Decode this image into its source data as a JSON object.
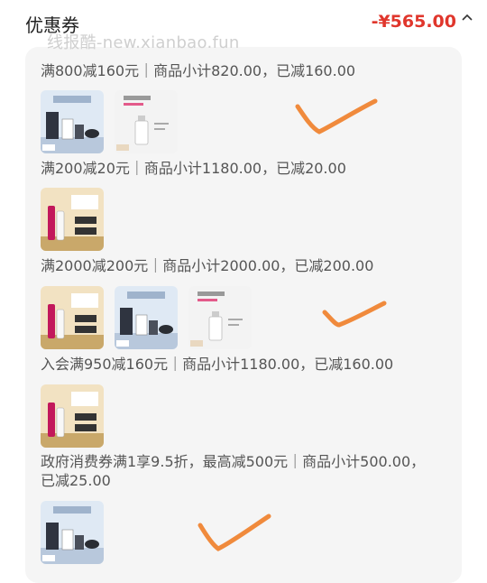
{
  "header": {
    "title": "优惠券",
    "amount": "-¥565.00",
    "chevron_icon": "chevron-up-icon"
  },
  "watermark": "线报酷-new.xianbao.fun",
  "coupons": [
    {
      "desc": "满800减160元｜商品小计820.00，已减160.00",
      "thumbs": [
        "blue-gift-set",
        "serum-bottle"
      ]
    },
    {
      "desc": "满200减20元｜商品小计1180.00，已减20.00",
      "thumbs": [
        "gold-gift-set"
      ]
    },
    {
      "desc": "满2000减200元｜商品小计2000.00，已减200.00",
      "thumbs": [
        "gold-gift-set",
        "blue-gift-set",
        "serum-bottle"
      ]
    },
    {
      "desc": "入会满950减160元｜商品小计1180.00，已减160.00",
      "thumbs": [
        "gold-gift-set"
      ]
    },
    {
      "desc_line1": "政府消费券满1享9.5折，最高减500元｜商品小计500.00，",
      "desc_line2": "已减25.00",
      "thumbs": [
        "blue-gift-set"
      ]
    }
  ],
  "annotation_color": "#f08a3c"
}
